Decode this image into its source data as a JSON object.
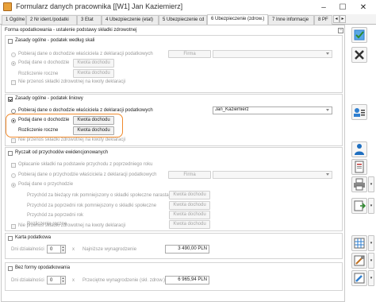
{
  "window": {
    "title": "Formularz danych pracownika [[W1] Jan Kaziemierz]",
    "minimize": "–",
    "maximize": "☐",
    "close": "✕"
  },
  "tabs": [
    {
      "label": "1 Ogólne"
    },
    {
      "label": "2 Nr ident./podatki"
    },
    {
      "label": "3 Etat"
    },
    {
      "label": "4 Ubezpieczenie (etat)"
    },
    {
      "label": "5 Ubezpieczenie cd"
    },
    {
      "label": "6 Ubezpieczenie (zdrow.)"
    },
    {
      "label": "7 Inne informacje"
    },
    {
      "label": "8 PF"
    }
  ],
  "group_title": "Forma opodatkowania - ustalenie podstawy składki zdrowotnej",
  "section1": {
    "title": "Zasady ogólne - podatek według skali",
    "opt_owner": "Pobieraj dane o dochodzie właściciela z deklaracji podatkowych",
    "firma_label": "Firma",
    "opt_income": "Podaj dane o dochodzie",
    "btn_income": "Kwota dochodu",
    "annual": "Rozliczenie roczne",
    "btn_annual": "Kwota dochodu",
    "no_transfer": "Nie przenoś składki zdrowotnej na kwoty deklaracji"
  },
  "section2": {
    "title": "Zasady ogólne - podatek liniowy",
    "opt_owner": "Pobieraj dane o dochodzie właściciela z deklaracji podatkowych",
    "owner_value": "Jan_Kaziemierz",
    "opt_income": "Podaj dane o dochodzie",
    "btn_income": "Kwota dochodu",
    "annual": "Rozliczenie roczne",
    "btn_annual": "Kwota dochodu",
    "no_transfer": "Nie przenoś składki zdrowotnej na kwoty deklaracji"
  },
  "section3": {
    "title": "Ryczałt od przychodów ewidencjonowanych",
    "paid_prev": "Opłacanie składki na podstawie przychodu z poprzedniego roku",
    "opt_owner": "Pobieraj dane o przychodzie właściciela z deklaracji podatkowych",
    "firma_label": "Firma",
    "opt_income": "Podaj dane o przychodzie",
    "row1": "Przychód za bieżący rok pomniejszony o składki społeczne narastająco",
    "row2": "Przychód za poprzedni rok pomniejszony o składki społeczne",
    "row3": "Przychód za poprzedni rok",
    "annual": "Rozliczenie roczne",
    "btn": "Kwota dochodu",
    "no_transfer": "Nie przenoś składki zdrowotnej na kwoty deklaracji"
  },
  "section4": {
    "title": "Karta podatkowa",
    "days_label": "Dni działalności",
    "days_value": "0",
    "x": "x",
    "min_label": "Najniższe wynagrodzenie",
    "min_value": "3 490,00 PLN"
  },
  "section5": {
    "title": "Bez formy opodatkowania",
    "days_label": "Dni działalności",
    "days_value": "0",
    "x": "x",
    "avg_label": "Przeciętne wynagrodzenie (skł. zdrow.)",
    "avg_value": "6 965,94 PLN"
  },
  "colors": {
    "highlight": "#f08a2c",
    "accent": "#2f7fd0"
  }
}
